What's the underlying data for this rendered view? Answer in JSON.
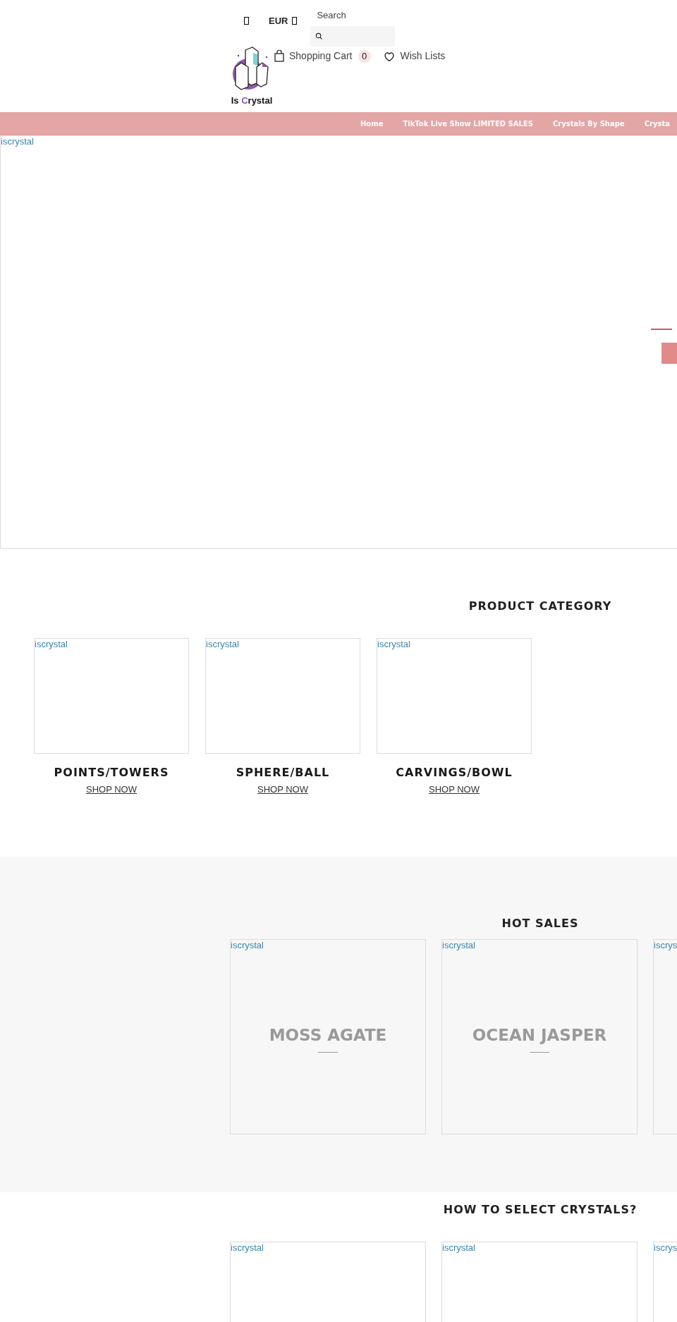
{
  "header": {
    "currency": "EUR",
    "search": {
      "label": "Search"
    },
    "cart": {
      "label": "Shopping Cart",
      "count": "0"
    },
    "wishlist": "Wish Lists",
    "logo": [
      {
        "text": "Is ",
        "accent": false
      },
      {
        "text": "C",
        "accent": true
      },
      {
        "text": "rystal",
        "accent": false
      }
    ]
  },
  "nav": [
    {
      "label": "Home"
    },
    {
      "label": "TikTok Live Show LIMITED SALES"
    },
    {
      "label": "Crystals By Shape"
    },
    {
      "label": "Crysta"
    }
  ],
  "hero": {
    "image_alt": "iscrystal"
  },
  "categories": {
    "title": "PRODUCT CATEGORY",
    "items": [
      {
        "image_alt": "iscrystal",
        "name": "POINTS/TOWERS",
        "link": "SHOP NOW"
      },
      {
        "image_alt": "iscrystal",
        "name": "SPHERE/BALL",
        "link": "SHOP NOW"
      },
      {
        "image_alt": "iscrystal",
        "name": "CARVINGS/BOWL",
        "link": "SHOP NOW"
      }
    ]
  },
  "hot_sales": {
    "title": "HOT SALES",
    "items": [
      {
        "image_alt": "iscrystal",
        "overlay": "MOSS AGATE"
      },
      {
        "image_alt": "iscrystal",
        "overlay": "OCEAN JASPER"
      },
      {
        "image_alt": "iscrys"
      }
    ]
  },
  "guides": {
    "title": "HOW TO SELECT CRYSTALS?",
    "items": [
      {
        "image_alt": "iscrystal"
      },
      {
        "image_alt": "iscrystal"
      },
      {
        "image_alt": "iscrys"
      }
    ]
  }
}
